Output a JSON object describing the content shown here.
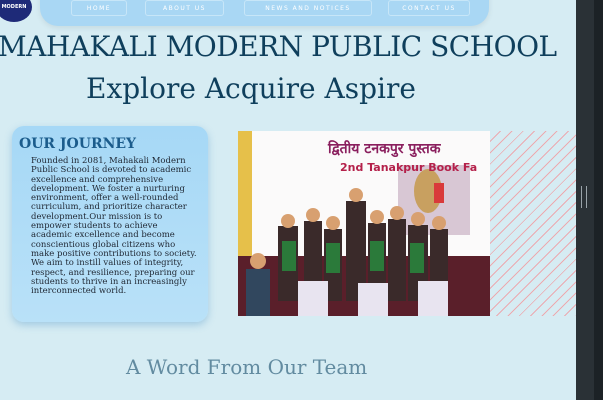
{
  "nav": {
    "items": [
      "HOME",
      "ABOUT US",
      "NEWS AND NOTICES",
      "CONTACT US"
    ],
    "logo_text": "MODERN"
  },
  "hero": {
    "school_name": "MAHAKALI MODERN PUBLIC SCHOOL",
    "tagline": "Explore Acquire Aspire"
  },
  "journey": {
    "title": "OUR JOURNEY",
    "body": "Founded in 2081, Mahakali Modern Public School is devoted to academic excellence and comprehensive development. We foster a nurturing environment, offer a well-rounded curriculum, and prioritize character development.Our mission is to empower students to achieve academic excellence and become conscientious global citizens who make positive contributions to society. We aim to instill values of integrity, respect, and resilience, preparing our students to thrive in an increasingly interconnected world."
  },
  "photo": {
    "banner_line1": "द्वितीय टनकपुर पुस्तक",
    "banner_line2": "2nd Tanakpur Book Fa"
  },
  "team": {
    "heading": "A Word From Our Team"
  },
  "colors": {
    "background": "#d6ecf3",
    "navbar": "#a9d7f4",
    "heading": "#0f3f5c",
    "card": "#a6d8f6"
  }
}
